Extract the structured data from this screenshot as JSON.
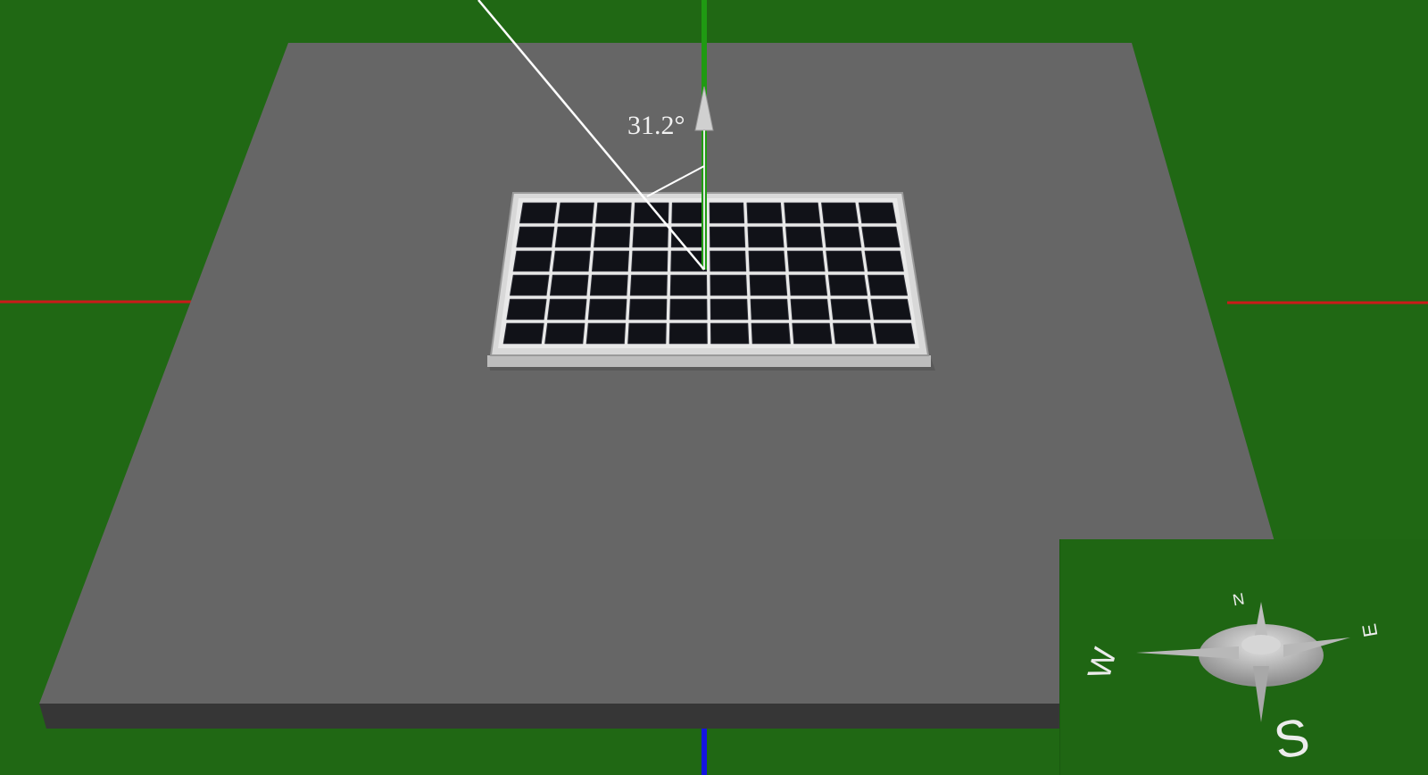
{
  "viewer": {
    "tilt_angle_label": "31.2°"
  },
  "compass": {
    "north": "N",
    "east": "E",
    "west": "W",
    "south": "S"
  },
  "colors": {
    "ground": "#206814",
    "platform_top": "#666666",
    "platform_edge": "#3a3a3a",
    "panel_frame": "#d8d8d8",
    "panel_cell": "#111218",
    "x_axis": "#cc1a1a",
    "y_axis": "#1f9a12",
    "z_axis": "#1414e0",
    "sun_ray": "#ffffff"
  },
  "panel": {
    "rows": 6,
    "cols": 10
  }
}
